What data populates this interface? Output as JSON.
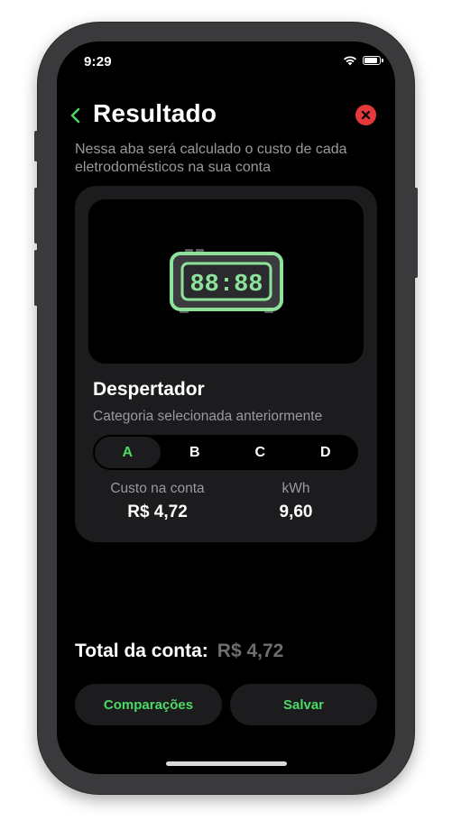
{
  "status_bar": {
    "time": "9:29"
  },
  "header": {
    "title": "Resultado",
    "subtitle": "Nessa aba será calculado o custo de cada eletrodomésticos na sua conta"
  },
  "card": {
    "device_name": "Despertador",
    "clock_display": "88:88",
    "category_label": "Categoria selecionada anteriormente",
    "categories": [
      "A",
      "B",
      "C",
      "D"
    ],
    "selected_category": "A",
    "cost_label": "Custo na conta",
    "cost_value": "R$ 4,72",
    "kwh_label": "kWh",
    "kwh_value": "9,60"
  },
  "total": {
    "label": "Total da conta:",
    "value": "R$ 4,72"
  },
  "buttons": {
    "compare_label": "Comparações",
    "save_label": "Salvar"
  },
  "colors": {
    "accent": "#4cd964",
    "close": "#e5383b",
    "card_bg": "#1c1c1e",
    "background": "#000000",
    "device_frame": "#3a3a3c"
  }
}
